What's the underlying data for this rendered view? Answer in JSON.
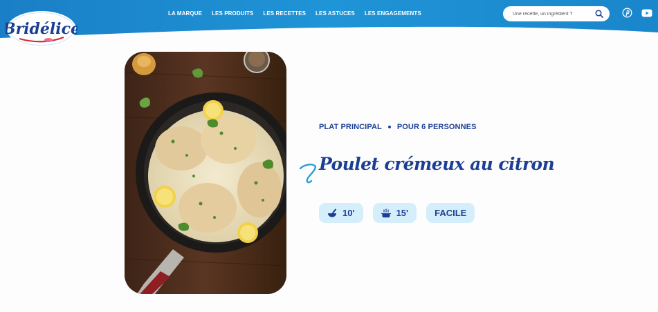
{
  "brand": {
    "logo_text": "Bridélice"
  },
  "nav": {
    "items": [
      {
        "label": "LA MARQUE"
      },
      {
        "label": "LES PRODUITS"
      },
      {
        "label": "LES RECETTES"
      },
      {
        "label": "LES ASTUCES"
      },
      {
        "label": "LES ENGAGEMENTS"
      }
    ]
  },
  "search": {
    "placeholder": "Une recette, un ingrédient ?"
  },
  "social": {
    "icons": [
      "pinterest-icon",
      "youtube-icon"
    ]
  },
  "recipe": {
    "category": "PLAT PRINCIPAL",
    "servings": "POUR 6 PERSONNES",
    "title": "Poulet crémeux au citron",
    "prep_time": "10'",
    "cook_time": "15'",
    "difficulty": "FACILE"
  },
  "colors": {
    "header_blue": "#1d8fd1",
    "brand_navy": "#1c3f94",
    "badge_bg": "#d5eefb"
  }
}
